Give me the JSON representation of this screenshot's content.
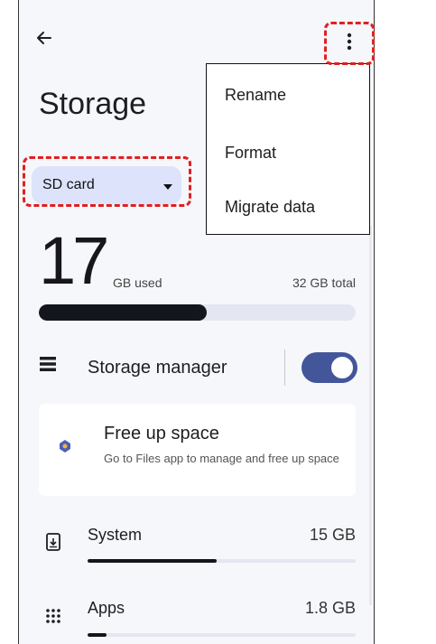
{
  "header": {
    "back_icon": "back-arrow-icon",
    "more_icon": "more-vert-icon",
    "title": "Storage"
  },
  "volume_selector": {
    "selected": "SD card",
    "caret_icon": "dropdown-caret-icon"
  },
  "usage": {
    "used_value": "17",
    "used_unit": "GB used",
    "total": "32 GB total",
    "used_fraction": 0.53
  },
  "storage_manager": {
    "icon": "storage-list-icon",
    "label": "Storage manager",
    "enabled": true
  },
  "free_up_space": {
    "icon": "files-app-icon",
    "title": "Free up space",
    "description": "Go to Files app to manage and free up space"
  },
  "categories": [
    {
      "icon": "system-update-icon",
      "label": "System",
      "size": "15 GB",
      "fraction": 0.48
    },
    {
      "icon": "apps-grid-icon",
      "label": "Apps",
      "size": "1.8 GB",
      "fraction": 0.07
    }
  ],
  "overflow_menu": {
    "items": [
      "Rename",
      "Format",
      "Migrate data"
    ]
  },
  "colors": {
    "accent": "#44569a",
    "chip_bg": "#dde3fb",
    "bar_fill": "#14161d",
    "highlight": "#e02020",
    "background": "#f6f7fb"
  }
}
